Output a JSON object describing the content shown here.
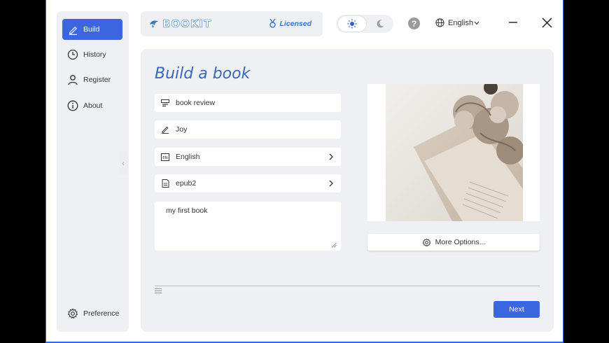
{
  "sidebar": {
    "items": [
      {
        "label": "Build",
        "icon": "pen-icon",
        "active": true
      },
      {
        "label": "History",
        "icon": "clock-icon",
        "active": false
      },
      {
        "label": "Register",
        "icon": "user-icon",
        "active": false
      },
      {
        "label": "About",
        "icon": "info-icon",
        "active": false
      }
    ],
    "preference_label": "Preference"
  },
  "header": {
    "logo_text": "BOOKIT",
    "licensed_label": "Licensed",
    "language": "English",
    "theme": "light"
  },
  "main": {
    "title": "Build a book",
    "fields": {
      "title_value": "book review",
      "author_value": "Joy",
      "language_value": "English",
      "format_value": "epub2",
      "description_value": "my first book"
    },
    "more_options_label": "More Options...",
    "next_label": "Next"
  },
  "colors": {
    "accent": "#3c66e0",
    "title": "#3a68b6",
    "panel": "#eef0f3",
    "window_border": "#2f6fd6"
  }
}
